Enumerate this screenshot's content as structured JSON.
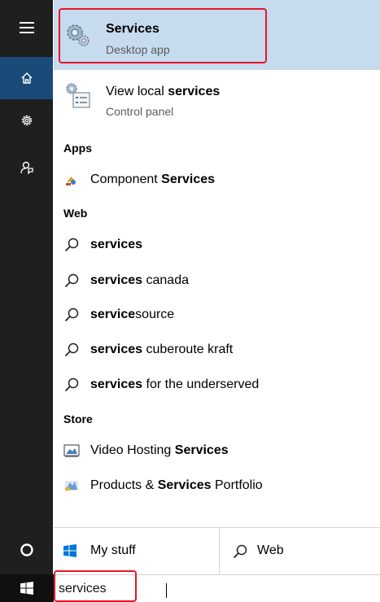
{
  "rail": {
    "items": [
      {
        "icon": "hamburger-menu-icon"
      },
      {
        "icon": "home-icon",
        "active": true
      },
      {
        "icon": "gear-icon"
      },
      {
        "icon": "feedback-icon"
      },
      {
        "icon": "cortana-circle-icon"
      }
    ]
  },
  "best_match": {
    "title": "Services",
    "subtitle": "Desktop app",
    "icon": "services-gear-icon"
  },
  "local_result": {
    "title_prefix": "View local ",
    "title_bold": "services",
    "subtitle": "Control panel",
    "icon": "control-panel-services-icon"
  },
  "sections": {
    "apps": "Apps",
    "web": "Web",
    "store": "Store"
  },
  "apps": [
    {
      "prefix": "Component ",
      "bold": "Services",
      "suffix": "",
      "icon": "component-services-icon"
    }
  ],
  "web": [
    {
      "bold": "services",
      "suffix": "",
      "icon": "search-icon"
    },
    {
      "bold": "services",
      "suffix": " canada",
      "icon": "search-icon"
    },
    {
      "bold": "service",
      "suffix": "source",
      "icon": "search-icon"
    },
    {
      "bold": "services",
      "suffix": " cuberoute kraft",
      "icon": "search-icon"
    },
    {
      "bold": "services",
      "suffix": " for the underserved",
      "icon": "search-icon"
    }
  ],
  "store": [
    {
      "prefix": "Video Hosting ",
      "bold": "Services",
      "suffix": "",
      "icon": "video-hosting-app-icon"
    },
    {
      "prefix": "Products & ",
      "bold": "Services",
      "suffix": " Portfolio",
      "icon": "products-portfolio-app-icon"
    }
  ],
  "filters": {
    "my_stuff": "My stuff",
    "web": "Web"
  },
  "search": {
    "value": "services"
  },
  "colors": {
    "rail_bg": "#1f1f1f",
    "rail_active": "#1a4b78",
    "best_match_bg": "#c7dbee",
    "highlight": "#e8142a",
    "windows_blue": "#0078d7"
  }
}
